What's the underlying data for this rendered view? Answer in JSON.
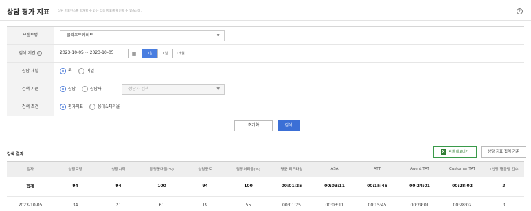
{
  "header": {
    "title": "상담 평가 지표",
    "subtitle": "상담 퍼포먼스를 평가할 수 있는 각종 지표를 확인할 수 있습니다.",
    "help_glyph": "?"
  },
  "filters": {
    "brand": {
      "label": "브랜드명",
      "value": "클라우드게이트",
      "arrow": "▼"
    },
    "period": {
      "label": "검색 기간",
      "info_glyph": "i",
      "range": "2023-10-05 ~ 2023-10-05",
      "calendar_glyph": "▦",
      "options": [
        "1일",
        "7일",
        "1개월"
      ],
      "selected": "1일"
    },
    "channel": {
      "label": "상담 채널",
      "options": [
        "톡",
        "메일"
      ],
      "selected": "톡"
    },
    "criteria": {
      "label": "검색 기준",
      "options": [
        "상담",
        "상담사"
      ],
      "selected": "상담",
      "agent_placeholder": "상담사 검색",
      "arrow": "▼"
    },
    "condition": {
      "label": "검색 조건",
      "options": [
        "평가지표",
        "응대&처리율"
      ],
      "selected": "평가지표"
    }
  },
  "actions": {
    "reset_label": "초기화",
    "search_label": "검색"
  },
  "results": {
    "title": "검색 결과",
    "excel_label": "엑셀 내보내기",
    "excel_icon_glyph": "X",
    "aggregate_label": "상담 지표 집계 기준",
    "columns": [
      "일자",
      "상담요청",
      "상담시작",
      "담당응대율(%)",
      "상담종료",
      "담당처리율(%)",
      "평균 리드타임",
      "ASA",
      "ATT",
      "Agent TAT",
      "Customer TAT",
      "1인당 핸들링 건수"
    ],
    "total_row": [
      "합계",
      "94",
      "94",
      "100",
      "94",
      "100",
      "00:01:25",
      "00:03:11",
      "00:15:45",
      "00:24:01",
      "00:28:02",
      "3"
    ],
    "rows": [
      [
        "2023-10-05",
        "34",
        "21",
        "61",
        "19",
        "55",
        "00:01:25",
        "00:03:11",
        "00:15:45",
        "00:24:01",
        "00:28:02",
        "3"
      ]
    ]
  },
  "colors": {
    "accent": "#3b6fd6",
    "excel": "#2e7d32",
    "header_bg": "#eeeeee"
  }
}
